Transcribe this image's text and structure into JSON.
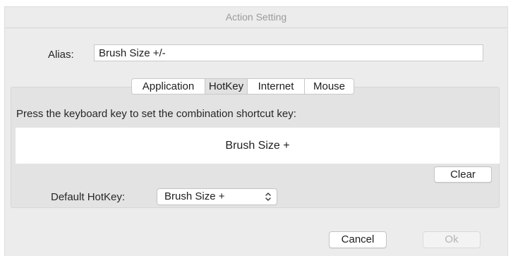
{
  "window": {
    "title": "Action Setting"
  },
  "alias": {
    "label": "Alias:",
    "value": "Brush Size +/-"
  },
  "tabs": [
    {
      "label": "Application",
      "active": false
    },
    {
      "label": "HotKey",
      "active": true
    },
    {
      "label": "Internet",
      "active": false
    },
    {
      "label": "Mouse",
      "active": false
    }
  ],
  "hotkey": {
    "instruction": "Press the keyboard key to set the combination shortcut key:",
    "captured": "Brush Size +",
    "clear_label": "Clear",
    "default_label": "Default HotKey:",
    "default_value": "Brush Size +",
    "default_icon": "up-down-chevron-icon"
  },
  "footer": {
    "cancel_label": "Cancel",
    "ok_label": "Ok",
    "ok_enabled": false
  }
}
